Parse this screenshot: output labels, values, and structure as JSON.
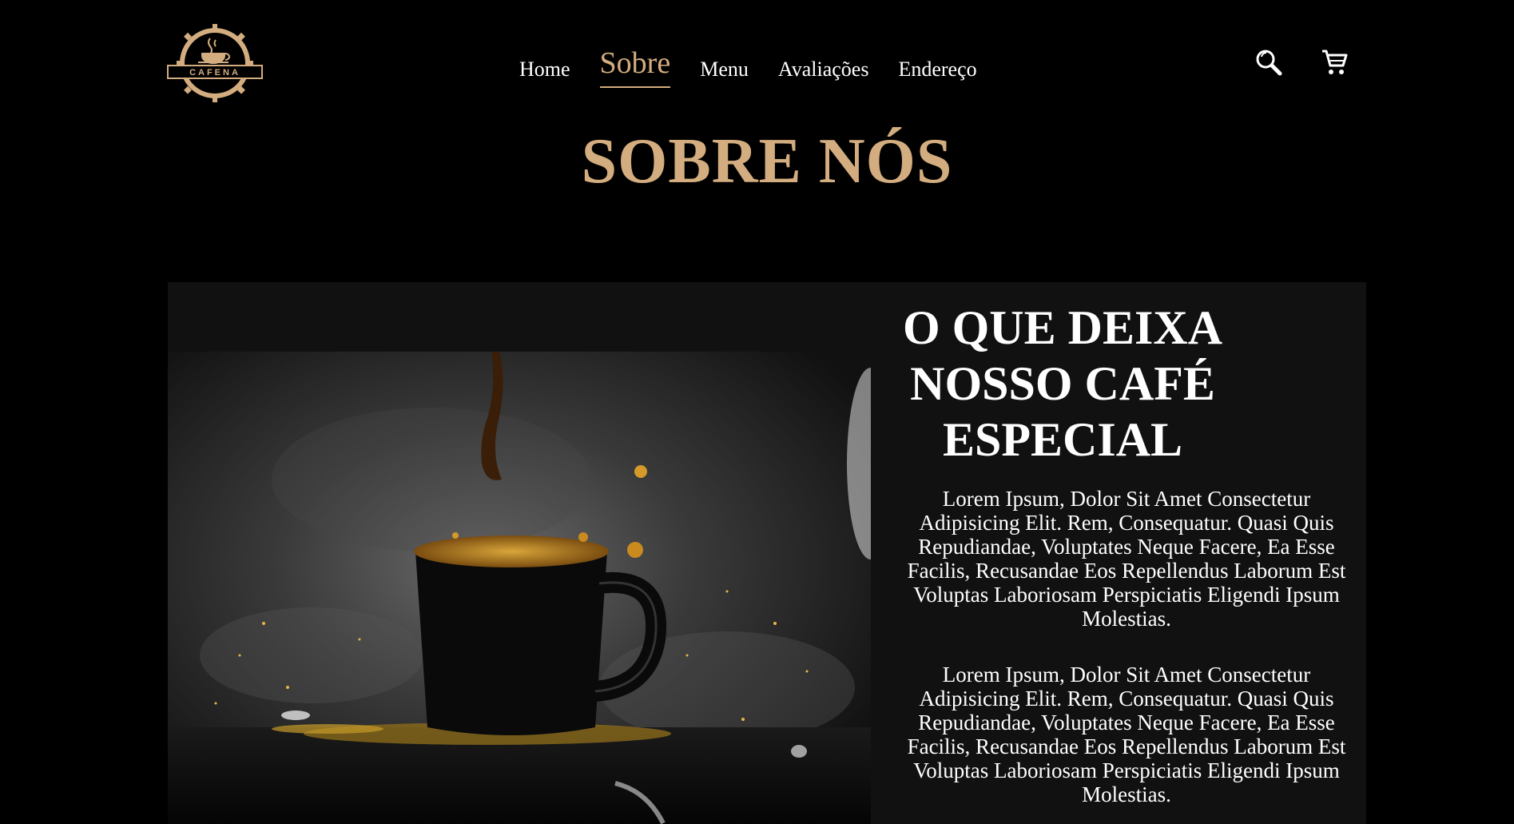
{
  "header": {
    "logo_text": "CAFENA",
    "nav": [
      {
        "label": "Home",
        "active": false
      },
      {
        "label": "Sobre",
        "active": true
      },
      {
        "label": "Menu",
        "active": false
      },
      {
        "label": "Avaliações",
        "active": false
      },
      {
        "label": "Endereço",
        "active": false
      }
    ],
    "icons": [
      "search-icon",
      "cart-icon"
    ]
  },
  "about": {
    "section_title": "SOBRE NÓS",
    "heading": "O QUE DEIXA NOSSO CAFÉ ESPECIAL",
    "paragraphs": [
      "Lorem Ipsum, Dolor Sit Amet Consectetur Adipisicing Elit. Rem, Consequatur. Quasi Quis Repudiandae, Voluptates Neque Facere, Ea Esse Facilis, Recusandae Eos Repellendus Laborum Est Voluptas Laboriosam Perspiciatis Eligendi Ipsum Molestias.",
      "Lorem Ipsum, Dolor Sit Amet Consectetur Adipisicing Elit. Rem, Consequatur. Quasi Quis Repudiandae, Voluptates Neque Facere, Ea Esse Facilis, Recusandae Eos Repellendus Laborum Est Voluptas Laboriosam Perspiciatis Eligendi Ipsum Molestias."
    ]
  },
  "colors": {
    "background": "#000000",
    "accent": "#d3ad7f",
    "panel": "#111111",
    "text": "#ffffff"
  }
}
